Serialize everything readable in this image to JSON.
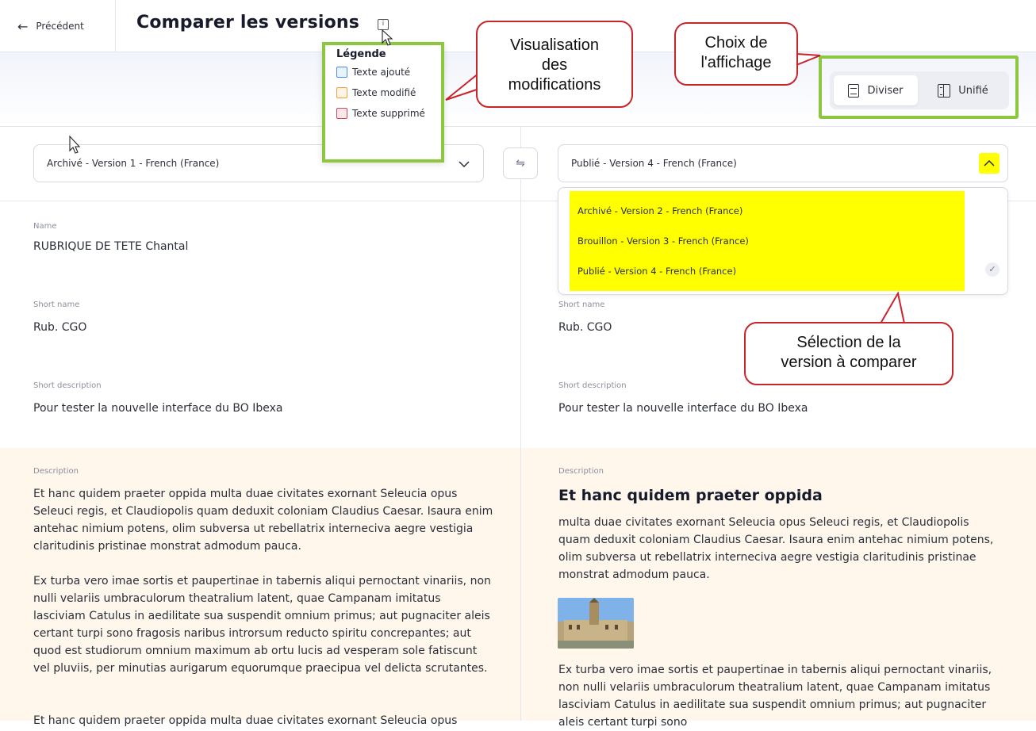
{
  "header": {
    "back_label": "Précédent",
    "title": "Comparer les versions",
    "info_glyph": "i"
  },
  "view_toggle": {
    "split_label": "Diviser",
    "unified_label": "Unifié",
    "active": "split"
  },
  "legend": {
    "title": "Légende",
    "items": [
      {
        "label": "Texte ajouté",
        "color": "#4a90e2",
        "fill": "#eaf2fc"
      },
      {
        "label": "Texte modifié",
        "color": "#f0a040",
        "fill": "#fff4e6"
      },
      {
        "label": "Texte supprimé",
        "color": "#d0455a",
        "fill": "#fbe8ec"
      }
    ]
  },
  "left": {
    "selected_version": "Archivé - Version 1 - French (France)",
    "fields": {
      "name_label": "Name",
      "name_value": "RUBRIQUE DE TETE Chantal",
      "short_name_label": "Short name",
      "short_name_value": "Rub. CGO",
      "short_desc_label": "Short description",
      "short_desc_value": "Pour tester la nouvelle interface du BO Ibexa",
      "description_label": "Description",
      "paragraphs": [
        "Et hanc quidem praeter oppida multa duae civitates exornant Seleucia opus Seleuci regis, et Claudiopolis quam deduxit coloniam Claudius Caesar. Isaura enim antehac nimium potens, olim subversa ut rebellatrix interneciva aegre vestigia claritudinis pristinae monstrat admodum pauca.",
        "Ex turba vero imae sortis et paupertinae in tabernis aliqui pernoctant vinariis, non nulli velariis umbraculorum theatralium latent, quae Campanam imitatus lasciviam Catulus in aedilitate sua suspendit omnium primus; aut pugnaciter aleis certant turpi sono fragosis naribus introrsum reducto spiritu concrepantes; aut quod est studiorum omnium maximum ab ortu lucis ad vesperam sole fatiscunt vel pluviis, per minutias aurigarum equorumque praecipua vel delicta scrutantes.",
        "Et hanc quidem praeter oppida multa duae civitates exornant Seleucia opus"
      ]
    }
  },
  "right": {
    "selected_version": "Publié - Version 4 - French (France)",
    "dropdown_options": [
      "Archivé - Version 2 - French (France)",
      "Brouillon - Version 3 - French (France)",
      "Publié - Version 4 - French (France)"
    ],
    "check_glyph": "✓",
    "fields": {
      "short_name_label": "Short name",
      "short_name_value": "Rub. CGO",
      "short_desc_label": "Short description",
      "short_desc_value": "Pour tester la nouvelle interface du BO Ibexa",
      "description_label": "Description",
      "heading": "Et hanc quidem praeter oppida",
      "paragraphs": [
        "multa duae civitates exornant Seleucia opus Seleuci regis, et Claudiopolis quam deduxit coloniam Claudius Caesar. Isaura enim antehac nimium potens, olim subversa ut rebellatrix interneciva aegre vestigia claritudinis pristinae monstrat admodum pauca.",
        "Ex turba vero imae sortis et paupertinae in tabernis aliqui pernoctant vinariis, non nulli velariis umbraculorum theatralium latent, quae Campanam imitatus lasciviam Catulus in aedilitate sua suspendit omnium primus; aut pugnaciter aleis certant turpi sono"
      ]
    }
  },
  "callouts": {
    "visualisation": [
      "Visualisation",
      "des",
      "modifications"
    ],
    "affichage": [
      "Choix de",
      "l'affichage"
    ],
    "selection": [
      "Sélection de la",
      "version à comparer"
    ]
  },
  "colors": {
    "annotation_green": "#8dc63f",
    "callout_red": "#c8252b",
    "highlight_yellow": "#ffff00",
    "description_bg": "#fff7ec"
  },
  "icons": [
    "arrow-left-icon",
    "info-icon",
    "document-icon",
    "split-view-icon",
    "chevron-down-icon",
    "chevron-up-icon",
    "swap-icon",
    "check-icon",
    "mouse-cursor-icon"
  ]
}
